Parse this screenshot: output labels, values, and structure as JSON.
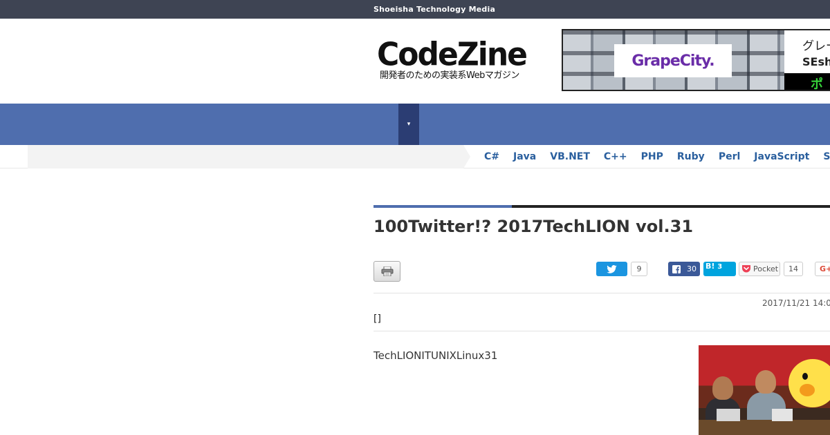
{
  "topbar": {
    "label": "Shoeisha Technology Media"
  },
  "header": {
    "logo_main": "CodeZine",
    "logo_sub": "開発者のための実装系Webマガジン",
    "ad": {
      "brand": "GrapeCity.",
      "line1": "グレー",
      "line2": "SEsho",
      "line3": "ポ"
    }
  },
  "nav": {
    "toggle_icon": "▾"
  },
  "langbar": {
    "languages": [
      "C#",
      "Java",
      "VB.NET",
      "C++",
      "PHP",
      "Ruby",
      "Perl",
      "JavaScript",
      "S"
    ]
  },
  "article": {
    "title": "100Twitter!? 2017TechLION vol.31",
    "date": "2017/11/21 14:0",
    "author": "[]",
    "lead": "TechLIONITUNIXLinux31"
  },
  "share": {
    "twitter_count": "9",
    "facebook_count": "30",
    "hatena_label": "B!",
    "hatena_count": "3",
    "pocket_label": "Pocket",
    "pocket_count": "14",
    "gplus_label": "G+"
  },
  "colors": {
    "topbar": "#3e4453",
    "nav": "#4f6eae",
    "nav_toggle": "#2b3d73",
    "lang_link": "#2a5f9e",
    "twitter": "#1b95e0",
    "facebook": "#3b5998",
    "hatena": "#00a4de"
  },
  "icons": {
    "print": "printer-icon",
    "twitter": "twitter-bird-icon",
    "facebook": "facebook-f-icon",
    "pocket": "pocket-icon"
  }
}
